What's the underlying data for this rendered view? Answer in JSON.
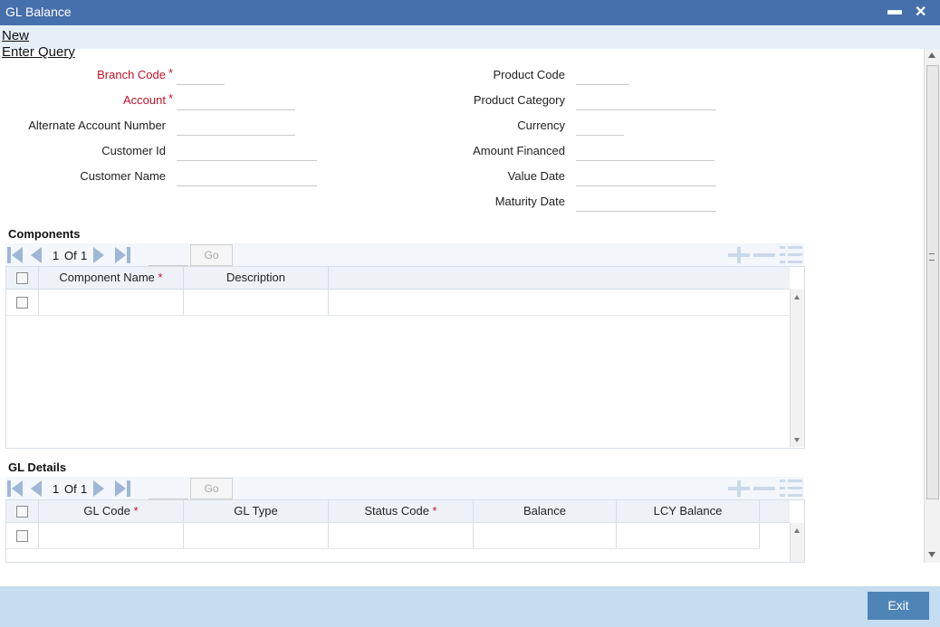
{
  "window": {
    "title": "GL Balance",
    "minimize_glyph": "▬",
    "close_glyph": "✕"
  },
  "menu": {
    "new": "New",
    "enter_query": "Enter Query"
  },
  "form": {
    "left": [
      {
        "label": "Branch Code",
        "required": "*"
      },
      {
        "label": "Account",
        "required": "*"
      },
      {
        "label": "Alternate Account Number",
        "required": ""
      },
      {
        "label": "Customer Id",
        "required": ""
      },
      {
        "label": "Customer Name",
        "required": ""
      }
    ],
    "right": [
      {
        "label": "Product Code"
      },
      {
        "label": "Product Category"
      },
      {
        "label": "Currency"
      },
      {
        "label": "Amount Financed"
      },
      {
        "label": "Value Date"
      },
      {
        "label": "Maturity Date"
      }
    ]
  },
  "components": {
    "title": "Components",
    "pager": {
      "current": "1",
      "of_label": "Of",
      "total": "1",
      "go_label": "Go"
    },
    "columns": [
      {
        "label": "Component Name",
        "required": "*"
      },
      {
        "label": "Description",
        "required": ""
      }
    ]
  },
  "gl_details": {
    "title": "GL Details",
    "pager": {
      "current": "1",
      "of_label": "Of",
      "total": "1",
      "go_label": "Go"
    },
    "columns": [
      {
        "label": "GL Code",
        "required": "*"
      },
      {
        "label": "GL Type",
        "required": ""
      },
      {
        "label": "Status Code",
        "required": "*"
      },
      {
        "label": "Balance",
        "required": ""
      },
      {
        "label": "LCY Balance",
        "required": ""
      }
    ]
  },
  "footer": {
    "exit_label": "Exit"
  },
  "colors": {
    "titlebar": "#4670ab",
    "required": "#c0132c",
    "exit_button": "#4f84b7",
    "footer": "#c4ddf0"
  }
}
